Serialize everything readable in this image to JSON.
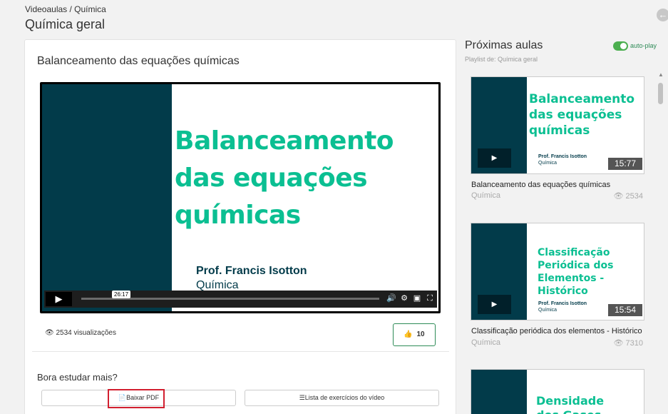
{
  "header": {
    "breadcrumb": "Videoaulas / Química",
    "title": "Química geral"
  },
  "video": {
    "title": "Balanceamento das equações químicas",
    "slide_title_lines": [
      "Balanceamento",
      "das equações",
      "químicas"
    ],
    "slide_prof": "Prof. Francis Isotton",
    "slide_subject": "Química",
    "time_tooltip": "26:17",
    "views": "2534 visualizações",
    "likes": "10"
  },
  "study": {
    "heading": "Bora estudar mais?",
    "pdf_label": "Baixar PDF",
    "exercises_label": "Lista de exercícios do vídeo"
  },
  "sidebar": {
    "title": "Próximas aulas",
    "subtitle": "Playlist de: Química geral",
    "autoplay_label": "auto-play",
    "autoplay_on": true,
    "items": [
      {
        "thumb_lines": [
          "Balanceamento",
          "das equações",
          "químicas"
        ],
        "thumb_prof": "Prof. Francis Isotton",
        "thumb_subj": "Química",
        "duration": "15:77",
        "title": "Balanceamento das equações químicas",
        "subject": "Química",
        "views": "2534"
      },
      {
        "thumb_lines": [
          "Classificação",
          "Periódica dos",
          "Elementos -",
          "Histórico"
        ],
        "thumb_prof": "Prof. Francis Isotton",
        "thumb_subj": "Química",
        "duration": "15:54",
        "title": "Classificação periódica dos elementos - Histórico",
        "subject": "Química",
        "views": "7310"
      },
      {
        "thumb_lines": [
          "Densidade",
          "dos Gases"
        ]
      }
    ]
  },
  "colors": {
    "slide_dark": "#023b4a",
    "slide_accent": "#0bbf92",
    "highlight": "#d21f2f",
    "like_border": "#2e8b57"
  }
}
